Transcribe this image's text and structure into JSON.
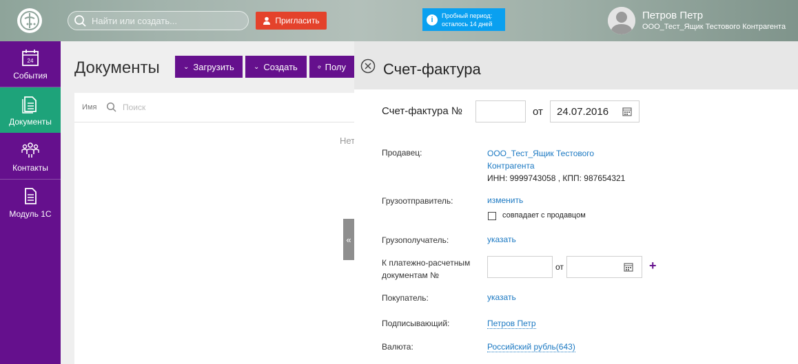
{
  "topbar": {
    "search_placeholder": "Найти или создать...",
    "invite_label": "Пригласить",
    "trial_line1": "Пробный период:",
    "trial_line2": "осталось 14 дней",
    "user_name": "Петров Петр",
    "org_name": "ООО_Тест_Ящик Тестового Контрагента"
  },
  "sidebar": {
    "items": [
      {
        "label": "События",
        "icon": "calendar-icon",
        "day": "24"
      },
      {
        "label": "Документы",
        "icon": "documents-icon"
      },
      {
        "label": "Контакты",
        "icon": "contacts-icon"
      },
      {
        "label": "Модуль 1С",
        "icon": "module-icon"
      }
    ]
  },
  "main": {
    "title": "Документы",
    "upload_label": "Загрузить",
    "create_label": "Создать",
    "receive_label": "Полу",
    "col_name": "Имя",
    "search_placeholder": "Поиск",
    "empty_text": "Нет"
  },
  "invoice": {
    "title": "Счет-фактура",
    "number_label": "Счет-фактура №",
    "number_value": "",
    "from_label": "от",
    "date_value": "24.07.2016",
    "seller_label": "Продавец:",
    "seller_name_line1": "ООО_Тест_Ящик Тестового",
    "seller_name_line2": "Контрагента",
    "seller_details": "ИНН: 9999743058 , КПП: 987654321",
    "shipper_label": "Грузоотправитель:",
    "shipper_action": "изменить",
    "same_as_seller": "совпадает с продавцом",
    "consignee_label": "Грузополучатель:",
    "consignee_action": "указать",
    "payment_label_line1": "К платежно-расчетным",
    "payment_label_line2": "документам №",
    "payment_from": "от",
    "buyer_label": "Покупатель:",
    "buyer_action": "указать",
    "signer_label": "Подписывающий:",
    "signer_value": "Петров Петр",
    "currency_label": "Валюта:",
    "currency_value": "Российский рубль(643)"
  },
  "colors": {
    "accent_purple": "#65108d",
    "active_green": "#1ea37a",
    "invite_red": "#e4422b",
    "trial_blue": "#0aa0f0",
    "link_blue": "#1a78c2"
  }
}
